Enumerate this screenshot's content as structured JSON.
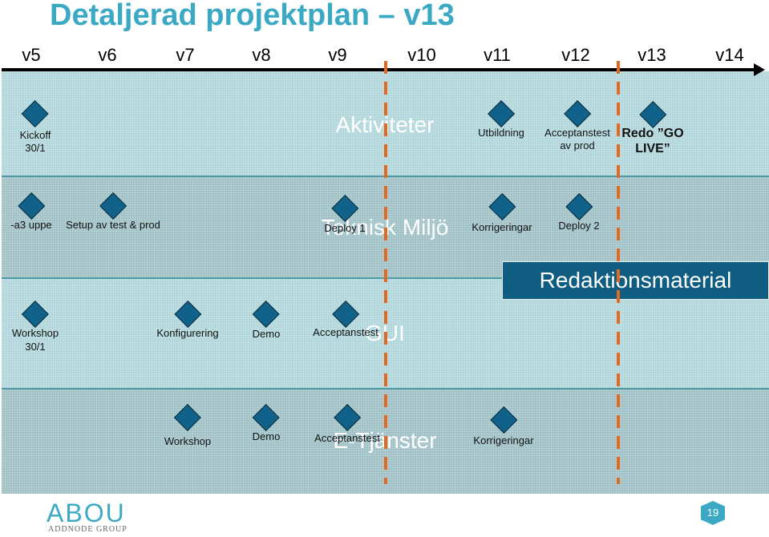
{
  "title": "Detaljerad projektplan – v13",
  "weeks": [
    "v5",
    "v6",
    "v7",
    "v8",
    "v9",
    "v10",
    "v11",
    "v12",
    "v13",
    "v14"
  ],
  "lanes": [
    {
      "name": "Aktiviteter",
      "milestones": [
        {
          "label": "Kickoff\n30/1",
          "week": "v5"
        },
        {
          "label": "Utbildning",
          "week": "v11"
        },
        {
          "label": "Acceptanstest\nav prod",
          "week": "v12"
        },
        {
          "label": "Redo ”GO\nLIVE”",
          "week": "v13",
          "bold": true
        }
      ]
    },
    {
      "name": "Teknisk Miljö",
      "milestones": [
        {
          "label": "-a3 uppe",
          "week": "v5"
        },
        {
          "label": "Setup av test & prod",
          "week": "v6"
        },
        {
          "label": "Deploy 1",
          "week": "v9"
        },
        {
          "label": "Korrigeringar",
          "week": "v11"
        },
        {
          "label": "Deploy 2",
          "week": "v12"
        }
      ]
    },
    {
      "name": "GUI",
      "milestones": [
        {
          "label": "Workshop\n30/1",
          "week": "v5"
        },
        {
          "label": "Konfigurering",
          "week": "v7"
        },
        {
          "label": "Demo",
          "week": "v8"
        },
        {
          "label": "Acceptanstest",
          "week": "v9"
        }
      ]
    },
    {
      "name": "E-Tjänster",
      "milestones": [
        {
          "label": "Workshop",
          "week": "v7"
        },
        {
          "label": "Demo",
          "week": "v8"
        },
        {
          "label": "Acceptanstest",
          "week": "v9"
        },
        {
          "label": "Korrigeringar",
          "week": "v11"
        }
      ]
    }
  ],
  "highlight_box": "Redaktionsmaterial",
  "deadlines": [
    "v9/v10",
    "v12/v13"
  ],
  "colors": {
    "title": "#3ba9c4",
    "diamond": "#11628a",
    "deadline": "#e06a22",
    "box": "#0f5e82"
  },
  "footer": {
    "logo": "ABOU",
    "logo_sub": "ADDNODE GROUP",
    "page_number": "19"
  }
}
